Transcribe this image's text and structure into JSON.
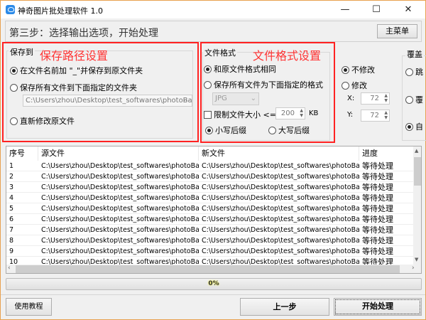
{
  "window": {
    "title": "神奇图片批处理软件 1.0",
    "minimize": "—",
    "maximize": "☐",
    "close": "✕"
  },
  "header": {
    "step": "第三步：选择输出选项，开始处理",
    "main_menu": "主菜单"
  },
  "save_to": {
    "group": "保存到",
    "annotation": "保存路径设置",
    "options": [
      {
        "label": "在文件名前加 \"_\"并保存到原文件夹",
        "checked": true
      },
      {
        "label": "保存所有文件到下面指定的文件夹",
        "checked": false
      },
      {
        "label": "直新修改原文件",
        "checked": false
      }
    ],
    "folder": "C:\\Users\\zhou\\Desktop\\test_softwares\\photoBatch",
    "browse": "..."
  },
  "format": {
    "group": "文件格式",
    "annotation": "文件格式设置",
    "same": "和原文件格式相同",
    "same_checked": true,
    "all": "保存所有文件为下面指定的格式",
    "format_value": "JPG",
    "limit_label": "限制文件大小 <=",
    "limit_checked": false,
    "limit_value": "200",
    "unit": "KB",
    "lower": "小写后缀",
    "lower_checked": true,
    "upper": "大写后缀"
  },
  "dpi": {
    "no_change": "不修改",
    "no_change_checked": true,
    "change": "修改",
    "x_label": "X:",
    "x": "72",
    "y_label": "Y:",
    "y": "72"
  },
  "overwrite": {
    "group": "覆盖",
    "options": [
      "跳",
      "覆",
      "自"
    ],
    "selected": 2
  },
  "table": {
    "columns": [
      "序号",
      "源文件",
      "新文件",
      "进度"
    ],
    "rows": [
      [
        "1",
        "C:\\Users\\zhou\\Desktop\\test_softwares\\photoBat...",
        "C:\\Users\\zhou\\Desktop\\test_softwares\\photoBat...",
        "等待处理"
      ],
      [
        "2",
        "C:\\Users\\zhou\\Desktop\\test_softwares\\photoBat...",
        "C:\\Users\\zhou\\Desktop\\test_softwares\\photoBat...",
        "等待处理"
      ],
      [
        "3",
        "C:\\Users\\zhou\\Desktop\\test_softwares\\photoBat...",
        "C:\\Users\\zhou\\Desktop\\test_softwares\\photoBat...",
        "等待处理"
      ],
      [
        "4",
        "C:\\Users\\zhou\\Desktop\\test_softwares\\photoBat...",
        "C:\\Users\\zhou\\Desktop\\test_softwares\\photoBat...",
        "等待处理"
      ],
      [
        "5",
        "C:\\Users\\zhou\\Desktop\\test_softwares\\photoBat...",
        "C:\\Users\\zhou\\Desktop\\test_softwares\\photoBat...",
        "等待处理"
      ],
      [
        "6",
        "C:\\Users\\zhou\\Desktop\\test_softwares\\photoBat...",
        "C:\\Users\\zhou\\Desktop\\test_softwares\\photoBat...",
        "等待处理"
      ],
      [
        "7",
        "C:\\Users\\zhou\\Desktop\\test_softwares\\photoBat...",
        "C:\\Users\\zhou\\Desktop\\test_softwares\\photoBat...",
        "等待处理"
      ],
      [
        "8",
        "C:\\Users\\zhou\\Desktop\\test_softwares\\photoBat...",
        "C:\\Users\\zhou\\Desktop\\test_softwares\\photoBat...",
        "等待处理"
      ],
      [
        "9",
        "C:\\Users\\zhou\\Desktop\\test_softwares\\photoBat...",
        "C:\\Users\\zhou\\Desktop\\test_softwares\\photoBat...",
        "等待处理"
      ],
      [
        "10",
        "C:\\Users\\zhou\\Desktop\\test_softwares\\photoBat...",
        "C:\\Users\\zhou\\Desktop\\test_softwares\\photoBat...",
        "等待处理"
      ]
    ]
  },
  "progress": {
    "value": 0,
    "label": "0%"
  },
  "footer": {
    "tutorial": "使用教程",
    "prev": "上一步",
    "start": "开始处理"
  }
}
